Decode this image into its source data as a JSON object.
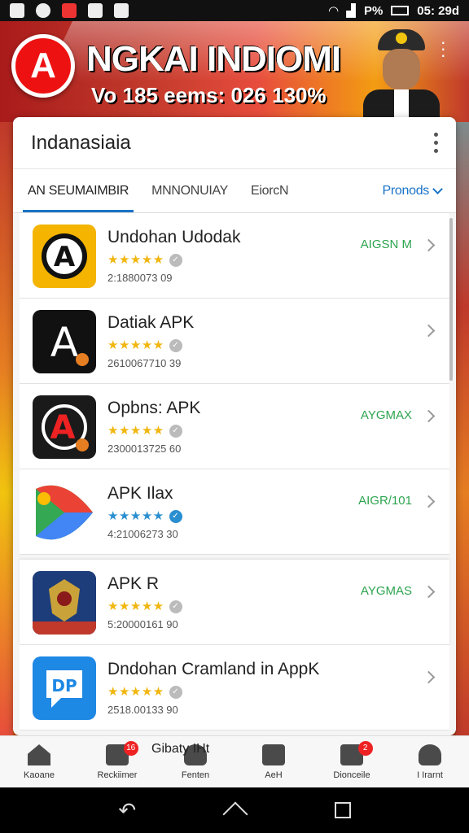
{
  "status_bar": {
    "battery": "P%",
    "time": "05: 29d"
  },
  "banner": {
    "title": "NGKAI INDIOMI",
    "subtitle": "Vo 185 eems: 026 130%",
    "logo_letter": "A"
  },
  "card": {
    "title": "Indanasiaia",
    "tabs": [
      {
        "label": "AN SEUMAIMBIR"
      },
      {
        "label": "MNNONUIAY"
      },
      {
        "label": "EiorcN"
      },
      {
        "label": "Pronods"
      }
    ]
  },
  "apps": [
    {
      "name": "Undohan Udodak",
      "meta": "2:1880073 09",
      "badge": "AIGSN M",
      "stars": "★★★★★",
      "icon_letter": "A",
      "icon_bg": "#f4b400"
    },
    {
      "name": "Datiak APK",
      "meta": "2610067710 39",
      "badge": "",
      "stars": "★★★★★",
      "icon_letter": "A",
      "icon_bg": "#111111"
    },
    {
      "name": "Opbns: APK",
      "meta": "2300013725 60",
      "badge": "AYGMAX",
      "stars": "★★★★★",
      "icon_letter": "A",
      "icon_bg": "#1a1a1a"
    },
    {
      "name": "APK Ilax",
      "meta": "4:21006273 30",
      "badge": "AIGR/101",
      "stars": "★★★★★",
      "icon_letter": "",
      "icon_bg": "#34a853"
    },
    {
      "name": "APK R",
      "meta": "5:20000161 90",
      "badge": "AYGMAS",
      "stars": "★★★★★",
      "icon_letter": "",
      "icon_bg": "#1d3d7a"
    },
    {
      "name": "Dndohan Cramland in AppK",
      "meta": "2518.00133 90",
      "badge": "",
      "stars": "★★★★★",
      "icon_letter": "DP",
      "icon_bg": "#1e88e5"
    }
  ],
  "bottom_nav": [
    {
      "label": "Kaoane",
      "icon": "home-icon",
      "badge": ""
    },
    {
      "label": "Reckiimer",
      "icon": "edit-icon",
      "badge": "16"
    },
    {
      "label": "Fenten",
      "icon": "person-icon",
      "badge": ""
    },
    {
      "label": "AeH",
      "icon": "chart-icon",
      "badge": ""
    },
    {
      "label": "Dionceile",
      "icon": "chat-icon",
      "badge": "2"
    },
    {
      "label": "I Irarnt",
      "icon": "account-icon",
      "badge": ""
    }
  ],
  "overlay_text": "Gibaty IHt"
}
